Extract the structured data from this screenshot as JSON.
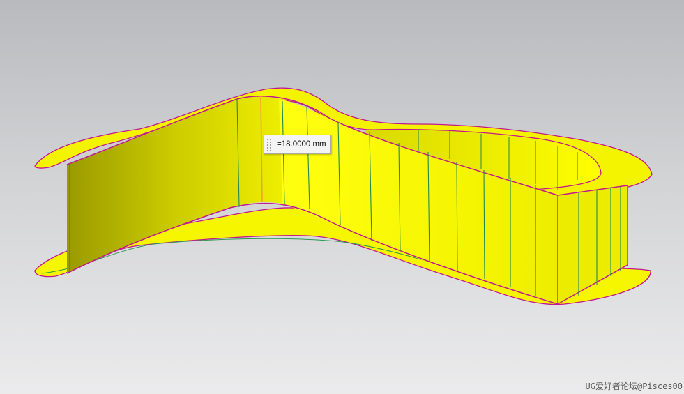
{
  "viewport": {
    "background_top": "#b9babd",
    "background_bottom": "#ebebec"
  },
  "model": {
    "face_color": "#ffff00",
    "shade_color": "#c9c900",
    "edge_color": "#c2188f",
    "iso_line_color": "#1f8a52",
    "highlight_line_color": "#f0a030"
  },
  "dimension": {
    "value": "=18.0000 mm"
  },
  "watermark": {
    "text": "UG爱好者论坛@Pisces00"
  }
}
